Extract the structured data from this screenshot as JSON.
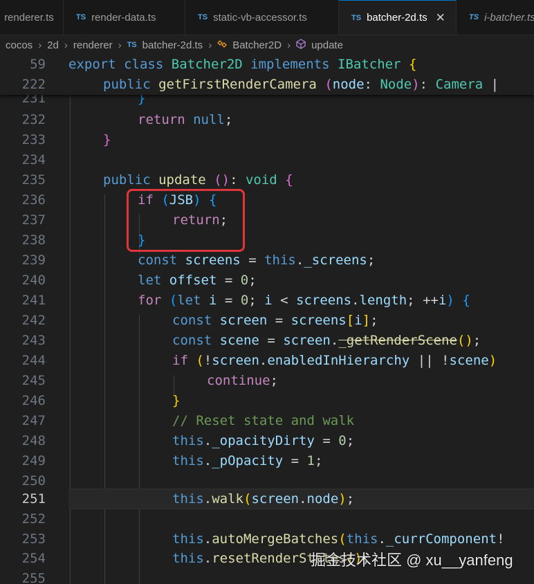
{
  "tabs": [
    {
      "label": "renderer.ts",
      "icon": "TS"
    },
    {
      "label": "render-data.ts",
      "icon": "TS"
    },
    {
      "label": "static-vb-accessor.ts",
      "icon": "TS"
    },
    {
      "label": "batcher-2d.ts",
      "icon": "TS",
      "active": true
    },
    {
      "label": "i-batcher.ts",
      "icon": "TS"
    }
  ],
  "close_glyph": "✕",
  "breadcrumb": {
    "items": [
      "cocos",
      "2d",
      "renderer",
      "batcher-2d.ts",
      "Batcher2D",
      "update"
    ],
    "separator": "›"
  },
  "sticky": [
    {
      "num": "59",
      "text": "export class Batcher2D implements IBatcher {"
    },
    {
      "num": "222",
      "text": "public getFirstRenderCamera (node: Node): Camera |"
    }
  ],
  "lines": [
    {
      "num": "231",
      "text": "}"
    },
    {
      "num": "232",
      "text": "return null;"
    },
    {
      "num": "233",
      "text": "}"
    },
    {
      "num": "234",
      "text": ""
    },
    {
      "num": "235",
      "text": "public update (): void {"
    },
    {
      "num": "236",
      "text": "if (JSB) {"
    },
    {
      "num": "237",
      "text": "return;"
    },
    {
      "num": "238",
      "text": "}"
    },
    {
      "num": "239",
      "text": "const screens = this._screens;"
    },
    {
      "num": "240",
      "text": "let offset = 0;"
    },
    {
      "num": "241",
      "text": "for (let i = 0; i < screens.length; ++i) {"
    },
    {
      "num": "242",
      "text": "const screen = screens[i];"
    },
    {
      "num": "243",
      "text": "const scene = screen._getRenderScene();"
    },
    {
      "num": "244",
      "text": "if (!screen.enabledInHierarchy || !scene)"
    },
    {
      "num": "245",
      "text": "continue;"
    },
    {
      "num": "246",
      "text": "}"
    },
    {
      "num": "247",
      "text": "// Reset state and walk"
    },
    {
      "num": "248",
      "text": "this._opacityDirty = 0;"
    },
    {
      "num": "249",
      "text": "this._pOpacity = 1;"
    },
    {
      "num": "250",
      "text": ""
    },
    {
      "num": "251",
      "text": "this.walk(screen.node);"
    },
    {
      "num": "252",
      "text": ""
    },
    {
      "num": "253",
      "text": "this.autoMergeBatches(this._currComponent!"
    },
    {
      "num": "254",
      "text": "this.resetRenderStates();"
    },
    {
      "num": "255",
      "text": ""
    }
  ],
  "current_line": "251",
  "watermark": "掘金技术社区 @ xu__yanfeng",
  "colors": {
    "accent": "#0078d4",
    "highlight_box": "#e0363b"
  }
}
